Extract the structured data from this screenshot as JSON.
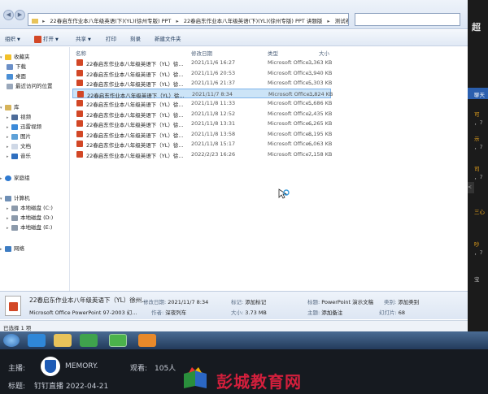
{
  "address": {
    "crumbs": [
      "22春启东作业本八年级英语(下)(YL)(徐州专版) PPT",
      "22春启东作业本八年级英语(下)(YL)(徐州专版) PPT 讲题版",
      "测试卷"
    ]
  },
  "toolbar": {
    "organize": "组织",
    "open": "打开",
    "share": "共享",
    "print": "打印",
    "burn": "刻录",
    "new_folder": "新建文件夹"
  },
  "sidebar": {
    "favorites": "收藏夹",
    "downloads": "下载",
    "desktop": "桌面",
    "recent": "最近访问的位置",
    "library": "库",
    "videos": "视频",
    "pictures_thunder": "迅雷视频",
    "images": "图片",
    "documents": "文档",
    "music": "音乐",
    "homegroup": "家庭组",
    "computer": "计算机",
    "disk_c": "本地磁盘 (C:)",
    "disk_d": "本地磁盘 (D:)",
    "disk_e": "本地磁盘 (E:)",
    "network": "网络"
  },
  "columns": {
    "name": "名称",
    "date": "修改日期",
    "type": "类型",
    "size": "大小"
  },
  "files": [
    {
      "name": "22春启东作业本八年级英语下（YL）徐...",
      "date": "2021/11/6 16:27",
      "type": "Microsoft Office...",
      "size": "3,363 KB",
      "selected": false
    },
    {
      "name": "22春启东作业本八年级英语下（YL）徐...",
      "date": "2021/11/6 20:53",
      "type": "Microsoft Office...",
      "size": "3,940 KB",
      "selected": false
    },
    {
      "name": "22春启东作业本八年级英语下（YL）徐...",
      "date": "2021/11/6 21:37",
      "type": "Microsoft Office...",
      "size": "5,303 KB",
      "selected": false
    },
    {
      "name": "22春启东作业本八年级英语下（YL）徐...",
      "date": "2021/11/7 8:34",
      "type": "Microsoft Office...",
      "size": "3,824 KB",
      "selected": true
    },
    {
      "name": "22春启东作业本八年级英语下（YL）徐...",
      "date": "2021/11/8 11:33",
      "type": "Microsoft Office...",
      "size": "5,686 KB",
      "selected": false
    },
    {
      "name": "22春启东作业本八年级英语下（YL）徐...",
      "date": "2021/11/8 12:52",
      "type": "Microsoft Office...",
      "size": "2,435 KB",
      "selected": false
    },
    {
      "name": "22春启东作业本八年级英语下（YL）徐...",
      "date": "2021/11/8 13:31",
      "type": "Microsoft Office...",
      "size": "6,265 KB",
      "selected": false
    },
    {
      "name": "22春启东作业本八年级英语下（YL）徐...",
      "date": "2021/11/8 13:58",
      "type": "Microsoft Office...",
      "size": "8,195 KB",
      "selected": false
    },
    {
      "name": "22春启东作业本八年级英语下（YL）徐...",
      "date": "2021/11/8 15:17",
      "type": "Microsoft Office...",
      "size": "6,063 KB",
      "selected": false
    },
    {
      "name": "22春启东作业本八年级英语下（YL）徐...",
      "date": "2022/2/23 16:26",
      "type": "Microsoft Office...",
      "size": "7,158 KB",
      "selected": false
    }
  ],
  "details": {
    "filename": "22春启东作业本八年级英语下（YL）徐州...",
    "filetype": "Microsoft Office PowerPoint 97-2003 幻...",
    "modified_label": "修改日期:",
    "modified": "2021/11/7 8:34",
    "author_label": "作者:",
    "author": "深夜列车",
    "tags_label": "标记:",
    "tags": "添加标记",
    "size_label": "大小:",
    "size": "3.73 MB",
    "title_label": "标题:",
    "title": "PowerPoint 演示文稿",
    "subject_label": "主题:",
    "subject": "添加备注",
    "category_label": "类别:",
    "category": "添加类别",
    "slides_label": "幻灯片:",
    "slides": "68"
  },
  "status": {
    "text": "已选择 1 项"
  },
  "rpanel": {
    "top": "超",
    "label1": "聊天",
    "a1": "可",
    "a2": "，7",
    "a3": "示",
    "a4": "，7",
    "b1": "司",
    "b2": "，7",
    "b3": "三心",
    "c1": "吵",
    "c2": "，7",
    "d1": "宝"
  },
  "overlay": {
    "host_label": "主播:",
    "host_name": "MEMORY.",
    "viewers_label": "观看:",
    "viewers": "105人",
    "title_label": "标题:",
    "title": "钉钉直播 2022-04-21"
  },
  "watermark": {
    "text": "彭城教育网"
  },
  "colors": {
    "selected_row": "#cce4f7",
    "ppt_icon": "#d24726",
    "watermark": "#d21f3c"
  }
}
